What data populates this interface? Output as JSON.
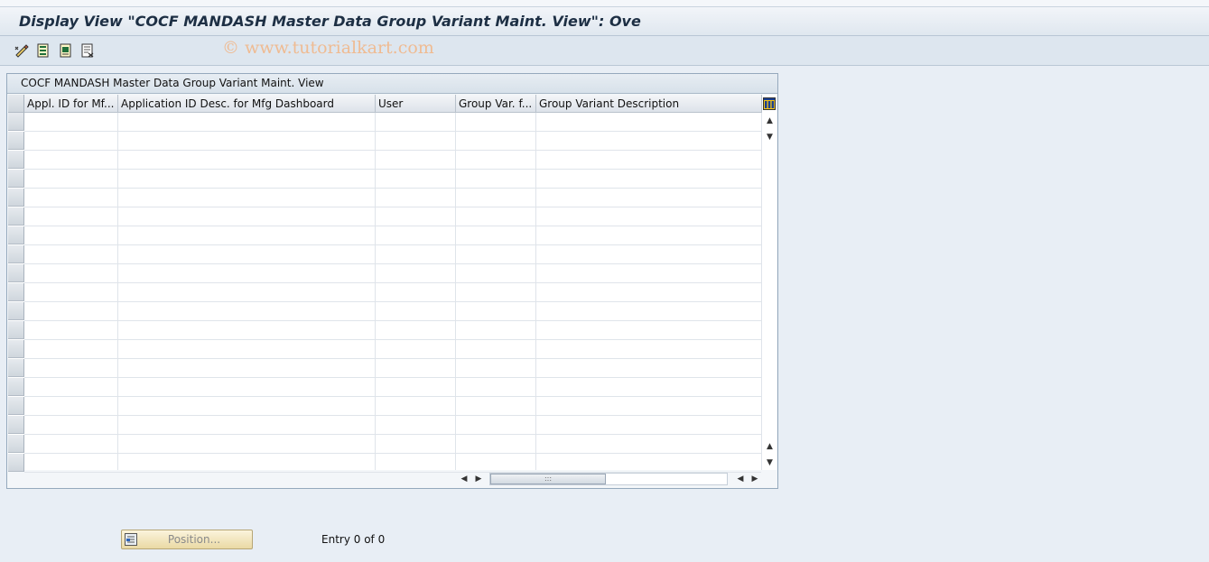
{
  "window": {
    "title": "Display View \"COCF MANDASH Master Data Group Variant Maint. View\": Ove"
  },
  "watermark": "© www.tutorialkart.com",
  "toolbar": {
    "buttons": [
      {
        "icon": "display-change-icon"
      },
      {
        "icon": "select-all-icon"
      },
      {
        "icon": "select-block-icon"
      },
      {
        "icon": "deselect-all-icon"
      }
    ]
  },
  "table": {
    "title": "COCF MANDASH Master Data Group Variant Maint. View",
    "columns": [
      {
        "label": "Appl. ID for Mf..."
      },
      {
        "label": "Application ID Desc. for Mfg Dashboard"
      },
      {
        "label": "User"
      },
      {
        "label": "Group Var. f..."
      },
      {
        "label": "Group Variant Description"
      }
    ],
    "rows": [],
    "visible_empty_rows": 19,
    "scroll_thumb_label": ":::"
  },
  "footer": {
    "position_button_label": "Position...",
    "entry_text": "Entry 0 of 0"
  },
  "colors": {
    "background": "#e8eef5",
    "title_text": "#1d2f44",
    "watermark": "#f0b98e",
    "position_button": "#f3e6bc"
  }
}
